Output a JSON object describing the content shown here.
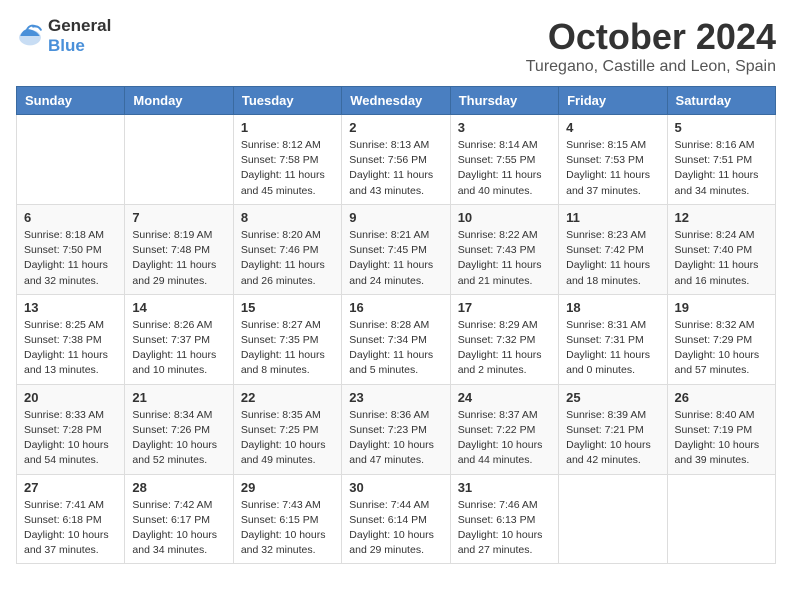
{
  "header": {
    "logo_general": "General",
    "logo_blue": "Blue",
    "month": "October 2024",
    "location": "Turegano, Castille and Leon, Spain"
  },
  "weekdays": [
    "Sunday",
    "Monday",
    "Tuesday",
    "Wednesday",
    "Thursday",
    "Friday",
    "Saturday"
  ],
  "weeks": [
    [
      {
        "day": "",
        "sunrise": "",
        "sunset": "",
        "daylight": ""
      },
      {
        "day": "",
        "sunrise": "",
        "sunset": "",
        "daylight": ""
      },
      {
        "day": "1",
        "sunrise": "Sunrise: 8:12 AM",
        "sunset": "Sunset: 7:58 PM",
        "daylight": "Daylight: 11 hours and 45 minutes."
      },
      {
        "day": "2",
        "sunrise": "Sunrise: 8:13 AM",
        "sunset": "Sunset: 7:56 PM",
        "daylight": "Daylight: 11 hours and 43 minutes."
      },
      {
        "day": "3",
        "sunrise": "Sunrise: 8:14 AM",
        "sunset": "Sunset: 7:55 PM",
        "daylight": "Daylight: 11 hours and 40 minutes."
      },
      {
        "day": "4",
        "sunrise": "Sunrise: 8:15 AM",
        "sunset": "Sunset: 7:53 PM",
        "daylight": "Daylight: 11 hours and 37 minutes."
      },
      {
        "day": "5",
        "sunrise": "Sunrise: 8:16 AM",
        "sunset": "Sunset: 7:51 PM",
        "daylight": "Daylight: 11 hours and 34 minutes."
      }
    ],
    [
      {
        "day": "6",
        "sunrise": "Sunrise: 8:18 AM",
        "sunset": "Sunset: 7:50 PM",
        "daylight": "Daylight: 11 hours and 32 minutes."
      },
      {
        "day": "7",
        "sunrise": "Sunrise: 8:19 AM",
        "sunset": "Sunset: 7:48 PM",
        "daylight": "Daylight: 11 hours and 29 minutes."
      },
      {
        "day": "8",
        "sunrise": "Sunrise: 8:20 AM",
        "sunset": "Sunset: 7:46 PM",
        "daylight": "Daylight: 11 hours and 26 minutes."
      },
      {
        "day": "9",
        "sunrise": "Sunrise: 8:21 AM",
        "sunset": "Sunset: 7:45 PM",
        "daylight": "Daylight: 11 hours and 24 minutes."
      },
      {
        "day": "10",
        "sunrise": "Sunrise: 8:22 AM",
        "sunset": "Sunset: 7:43 PM",
        "daylight": "Daylight: 11 hours and 21 minutes."
      },
      {
        "day": "11",
        "sunrise": "Sunrise: 8:23 AM",
        "sunset": "Sunset: 7:42 PM",
        "daylight": "Daylight: 11 hours and 18 minutes."
      },
      {
        "day": "12",
        "sunrise": "Sunrise: 8:24 AM",
        "sunset": "Sunset: 7:40 PM",
        "daylight": "Daylight: 11 hours and 16 minutes."
      }
    ],
    [
      {
        "day": "13",
        "sunrise": "Sunrise: 8:25 AM",
        "sunset": "Sunset: 7:38 PM",
        "daylight": "Daylight: 11 hours and 13 minutes."
      },
      {
        "day": "14",
        "sunrise": "Sunrise: 8:26 AM",
        "sunset": "Sunset: 7:37 PM",
        "daylight": "Daylight: 11 hours and 10 minutes."
      },
      {
        "day": "15",
        "sunrise": "Sunrise: 8:27 AM",
        "sunset": "Sunset: 7:35 PM",
        "daylight": "Daylight: 11 hours and 8 minutes."
      },
      {
        "day": "16",
        "sunrise": "Sunrise: 8:28 AM",
        "sunset": "Sunset: 7:34 PM",
        "daylight": "Daylight: 11 hours and 5 minutes."
      },
      {
        "day": "17",
        "sunrise": "Sunrise: 8:29 AM",
        "sunset": "Sunset: 7:32 PM",
        "daylight": "Daylight: 11 hours and 2 minutes."
      },
      {
        "day": "18",
        "sunrise": "Sunrise: 8:31 AM",
        "sunset": "Sunset: 7:31 PM",
        "daylight": "Daylight: 11 hours and 0 minutes."
      },
      {
        "day": "19",
        "sunrise": "Sunrise: 8:32 AM",
        "sunset": "Sunset: 7:29 PM",
        "daylight": "Daylight: 10 hours and 57 minutes."
      }
    ],
    [
      {
        "day": "20",
        "sunrise": "Sunrise: 8:33 AM",
        "sunset": "Sunset: 7:28 PM",
        "daylight": "Daylight: 10 hours and 54 minutes."
      },
      {
        "day": "21",
        "sunrise": "Sunrise: 8:34 AM",
        "sunset": "Sunset: 7:26 PM",
        "daylight": "Daylight: 10 hours and 52 minutes."
      },
      {
        "day": "22",
        "sunrise": "Sunrise: 8:35 AM",
        "sunset": "Sunset: 7:25 PM",
        "daylight": "Daylight: 10 hours and 49 minutes."
      },
      {
        "day": "23",
        "sunrise": "Sunrise: 8:36 AM",
        "sunset": "Sunset: 7:23 PM",
        "daylight": "Daylight: 10 hours and 47 minutes."
      },
      {
        "day": "24",
        "sunrise": "Sunrise: 8:37 AM",
        "sunset": "Sunset: 7:22 PM",
        "daylight": "Daylight: 10 hours and 44 minutes."
      },
      {
        "day": "25",
        "sunrise": "Sunrise: 8:39 AM",
        "sunset": "Sunset: 7:21 PM",
        "daylight": "Daylight: 10 hours and 42 minutes."
      },
      {
        "day": "26",
        "sunrise": "Sunrise: 8:40 AM",
        "sunset": "Sunset: 7:19 PM",
        "daylight": "Daylight: 10 hours and 39 minutes."
      }
    ],
    [
      {
        "day": "27",
        "sunrise": "Sunrise: 7:41 AM",
        "sunset": "Sunset: 6:18 PM",
        "daylight": "Daylight: 10 hours and 37 minutes."
      },
      {
        "day": "28",
        "sunrise": "Sunrise: 7:42 AM",
        "sunset": "Sunset: 6:17 PM",
        "daylight": "Daylight: 10 hours and 34 minutes."
      },
      {
        "day": "29",
        "sunrise": "Sunrise: 7:43 AM",
        "sunset": "Sunset: 6:15 PM",
        "daylight": "Daylight: 10 hours and 32 minutes."
      },
      {
        "day": "30",
        "sunrise": "Sunrise: 7:44 AM",
        "sunset": "Sunset: 6:14 PM",
        "daylight": "Daylight: 10 hours and 29 minutes."
      },
      {
        "day": "31",
        "sunrise": "Sunrise: 7:46 AM",
        "sunset": "Sunset: 6:13 PM",
        "daylight": "Daylight: 10 hours and 27 minutes."
      },
      {
        "day": "",
        "sunrise": "",
        "sunset": "",
        "daylight": ""
      },
      {
        "day": "",
        "sunrise": "",
        "sunset": "",
        "daylight": ""
      }
    ]
  ]
}
